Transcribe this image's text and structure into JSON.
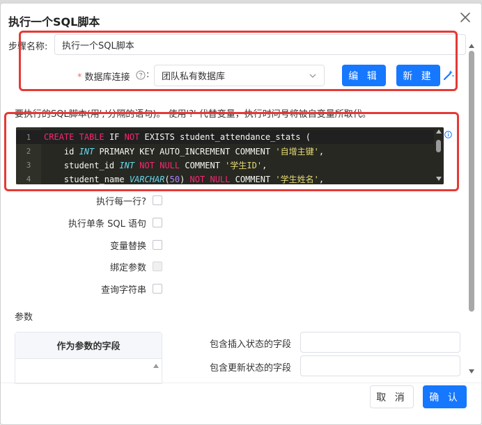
{
  "dialog": {
    "title": "执行一个SQL脚本"
  },
  "step_name": {
    "label": "步骤名称:",
    "value": "执行一个SQL脚本"
  },
  "db_connection": {
    "required_mark": "*",
    "label": "数据库连接",
    "help_icon": "question-circle-icon",
    "selected": "团队私有数据库",
    "edit_label": "编 辑",
    "new_label": "新 建",
    "wizard_icon": "magic-wand-icon"
  },
  "script": {
    "hint": "要执行的SQL脚本(用';'分隔的语句)。 使用'?' 代替变量，执行时问号将被自变量所取代。",
    "info_icon": "info-circle-icon",
    "lines": [
      {
        "n": "1",
        "parts": [
          [
            "kw",
            "CREATE"
          ],
          [
            "txt",
            " "
          ],
          [
            "kw",
            "TABLE"
          ],
          [
            "txt",
            " IF "
          ],
          [
            "kw",
            "NOT"
          ],
          [
            "txt",
            " EXISTS student_attendance_stats ("
          ]
        ]
      },
      {
        "n": "2",
        "parts": [
          [
            "txt",
            "    id "
          ],
          [
            "ty",
            "INT"
          ],
          [
            "txt",
            " PRIMARY KEY AUTO_INCREMENT COMMENT "
          ],
          [
            "str",
            "'自增主键'"
          ],
          [
            "txt",
            ","
          ]
        ]
      },
      {
        "n": "3",
        "parts": [
          [
            "txt",
            "    student_id "
          ],
          [
            "ty",
            "INT"
          ],
          [
            "txt",
            " "
          ],
          [
            "kw",
            "NOT"
          ],
          [
            "txt",
            " "
          ],
          [
            "kw",
            "NULL"
          ],
          [
            "txt",
            " COMMENT "
          ],
          [
            "str",
            "'学生ID'"
          ],
          [
            "txt",
            ","
          ]
        ]
      },
      {
        "n": "4",
        "parts": [
          [
            "txt",
            "    student_name "
          ],
          [
            "ty",
            "VARCHAR"
          ],
          [
            "txt",
            "("
          ],
          [
            "num",
            "50"
          ],
          [
            "txt",
            ") "
          ],
          [
            "kw",
            "NOT"
          ],
          [
            "txt",
            " "
          ],
          [
            "kw",
            "NULL"
          ],
          [
            "txt",
            " COMMENT "
          ],
          [
            "str",
            "'学生姓名'"
          ],
          [
            "txt",
            ","
          ]
        ]
      }
    ]
  },
  "options": [
    {
      "label": "执行每一行?",
      "disabled": false
    },
    {
      "label": "执行单条 SQL 语句",
      "disabled": false
    },
    {
      "label": "变量替换",
      "disabled": false
    },
    {
      "label": "绑定参数",
      "disabled": true
    },
    {
      "label": "查询字符串",
      "disabled": false
    }
  ],
  "params": {
    "section_label": "参数",
    "table_header": "作为参数的字段",
    "insert_status_label": "包含插入状态的字段",
    "update_status_label": "包含更新状态的字段"
  },
  "footer": {
    "cancel_label": "取 消",
    "confirm_label": "确 认"
  },
  "colors": {
    "primary": "#1677ff",
    "highlight_border": "#e53935",
    "editor_bg": "#272822"
  }
}
